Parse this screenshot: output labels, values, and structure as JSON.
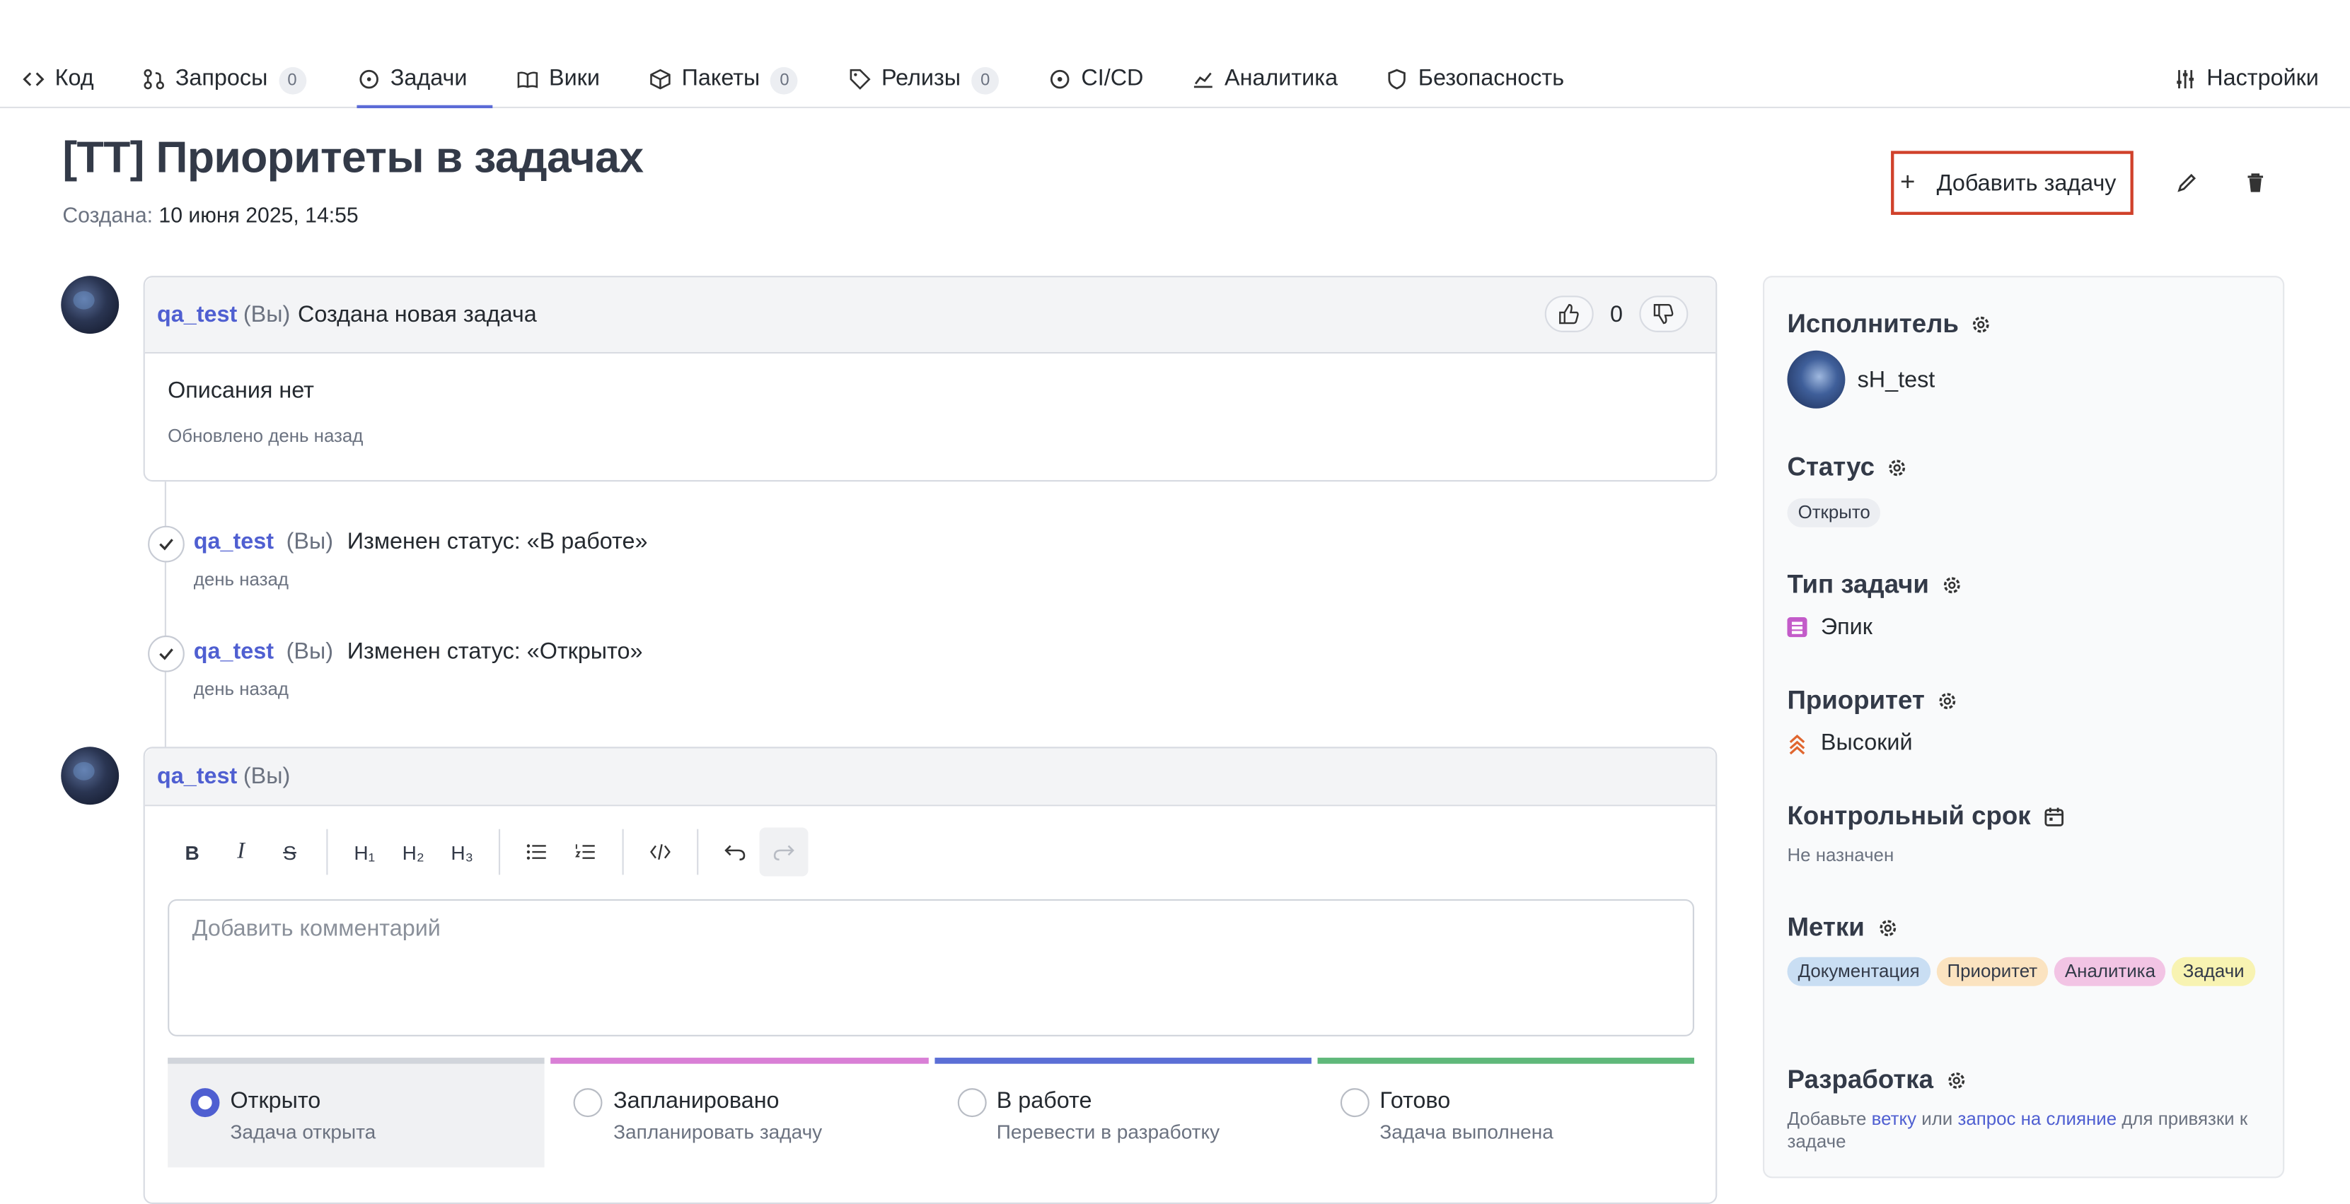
{
  "tabs": [
    {
      "label": "Код",
      "icon": "code-icon"
    },
    {
      "label": "Запросы",
      "count": "0",
      "icon": "merge-request-icon"
    },
    {
      "label": "Задачи",
      "icon": "issue-icon",
      "active": true
    },
    {
      "label": "Вики",
      "icon": "book-icon"
    },
    {
      "label": "Пакеты",
      "count": "0",
      "icon": "package-icon"
    },
    {
      "label": "Релизы",
      "count": "0",
      "icon": "tag-icon"
    },
    {
      "label": "CI/CD",
      "icon": "pipeline-icon"
    },
    {
      "label": "Аналитика",
      "icon": "chart-icon"
    },
    {
      "label": "Безопасность",
      "icon": "shield-icon"
    },
    {
      "label": "Настройки",
      "icon": "sliders-icon"
    }
  ],
  "issue": {
    "title": "[TT] Приоритеты в задачах",
    "created_label": "Создана:",
    "created_value": "10 июня 2025, 14:55"
  },
  "actions": {
    "add_task": "Добавить задачу"
  },
  "description_card": {
    "user": "qa_test",
    "you": "(Вы)",
    "message": "Создана новая задача",
    "likes": "0",
    "body": "Описания нет",
    "updated": "Обновлено день назад"
  },
  "timeline": [
    {
      "user": "qa_test",
      "you": "(Вы)",
      "message": "Изменен статус: «В работе»",
      "time": "день назад"
    },
    {
      "user": "qa_test",
      "you": "(Вы)",
      "message": "Изменен статус: «Открыто»",
      "time": "день назад"
    }
  ],
  "comment": {
    "user": "qa_test",
    "you": "(Вы)",
    "placeholder": "Добавить комментарий",
    "toolbar": {
      "bold": "B",
      "italic": "I",
      "strike": "S",
      "h1": "H₁",
      "h2": "H₂",
      "h3": "H₃"
    },
    "states": [
      {
        "label": "Открыто",
        "sub": "Задача открыта",
        "color": "#d1d5db",
        "selected": true
      },
      {
        "label": "Запланировано",
        "sub": "Запланировать задачу",
        "color": "#d97fd6"
      },
      {
        "label": "В работе",
        "sub": "Перевести в разработку",
        "color": "#5b6fd6"
      },
      {
        "label": "Готово",
        "sub": "Задача выполнена",
        "color": "#5fb87a"
      }
    ]
  },
  "sidebar": {
    "assignee": {
      "title": "Исполнитель",
      "name": "sH_test"
    },
    "status": {
      "title": "Статус",
      "value": "Открыто"
    },
    "type": {
      "title": "Тип задачи",
      "value": "Эпик",
      "color": "#c35bc9"
    },
    "priority": {
      "title": "Приоритет",
      "value": "Высокий",
      "color": "#e0662f"
    },
    "deadline": {
      "title": "Контрольный срок",
      "value": "Не назначен"
    },
    "labels": {
      "title": "Метки",
      "items": [
        {
          "text": "Документация",
          "bg": "#c9def3"
        },
        {
          "text": "Приоритет",
          "bg": "#fbe3c0"
        },
        {
          "text": "Аналитика",
          "bg": "#f2c4e4"
        },
        {
          "text": "Задачи",
          "bg": "#f8f3b2"
        }
      ]
    },
    "development": {
      "title": "Разработка",
      "text_1": "Добавьте",
      "link_1": "ветку",
      "text_2": "или",
      "link_2": "запрос на слияние",
      "text_3": "для привязки к задаче"
    }
  },
  "colors": {
    "accent": "#4f5fd1",
    "highlight_border": "#d0412a"
  }
}
